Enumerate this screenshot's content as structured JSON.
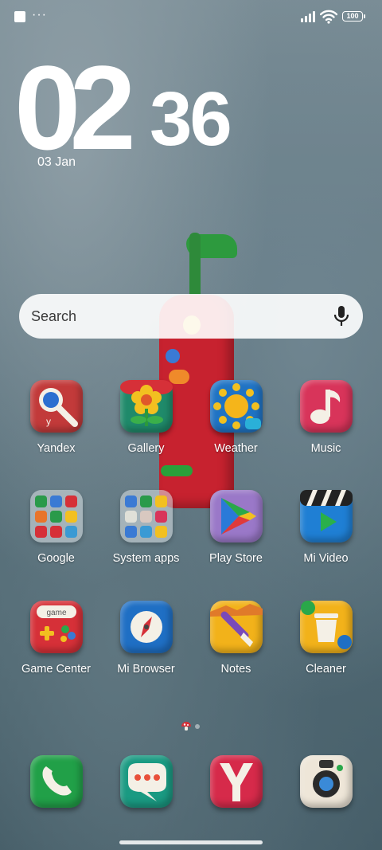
{
  "status_bar": {
    "menu_dots": "···",
    "battery": "100"
  },
  "clock": {
    "hours": "02",
    "minutes": "36",
    "date": "03 Jan"
  },
  "search": {
    "placeholder": "Search"
  },
  "apps": [
    {
      "label": "Yandex",
      "icon": "yandex-magnifier-icon",
      "color": "#c23a3a"
    },
    {
      "label": "Gallery",
      "icon": "flower-icon",
      "color": "#1f8a6a"
    },
    {
      "label": "Weather",
      "icon": "sun-icon",
      "color": "#1f73c4"
    },
    {
      "label": "Music",
      "icon": "music-note-icon",
      "color": "#d8345a"
    },
    {
      "label": "Google",
      "icon": "folder-icon",
      "color": "#dce4e8"
    },
    {
      "label": "System apps",
      "icon": "folder-icon",
      "color": "#dce4e8"
    },
    {
      "label": "Play Store",
      "icon": "play-store-icon",
      "color": "#9a78c8"
    },
    {
      "label": "Mi Video",
      "icon": "clapperboard-icon",
      "color": "#1f7fd4"
    },
    {
      "label": "Game Center",
      "icon": "game-controller-icon",
      "color": "#d63038"
    },
    {
      "label": "Mi Browser",
      "icon": "compass-icon",
      "color": "#1f6fc4"
    },
    {
      "label": "Notes",
      "icon": "paintbrush-icon",
      "color": "#f2b21a"
    },
    {
      "label": "Cleaner",
      "icon": "trash-bin-icon",
      "color": "#f2b21a"
    }
  ],
  "game_icon_text": "game",
  "dock": [
    {
      "name": "phone",
      "icon": "phone-icon",
      "color": "#21a048"
    },
    {
      "name": "messaging",
      "icon": "chat-bubble-icon",
      "color": "#1a9a82"
    },
    {
      "name": "yandex-browser",
      "icon": "yandex-y-icon",
      "color": "#d62a4a"
    },
    {
      "name": "camera",
      "icon": "camera-icon",
      "color": "#eee6d8"
    }
  ]
}
